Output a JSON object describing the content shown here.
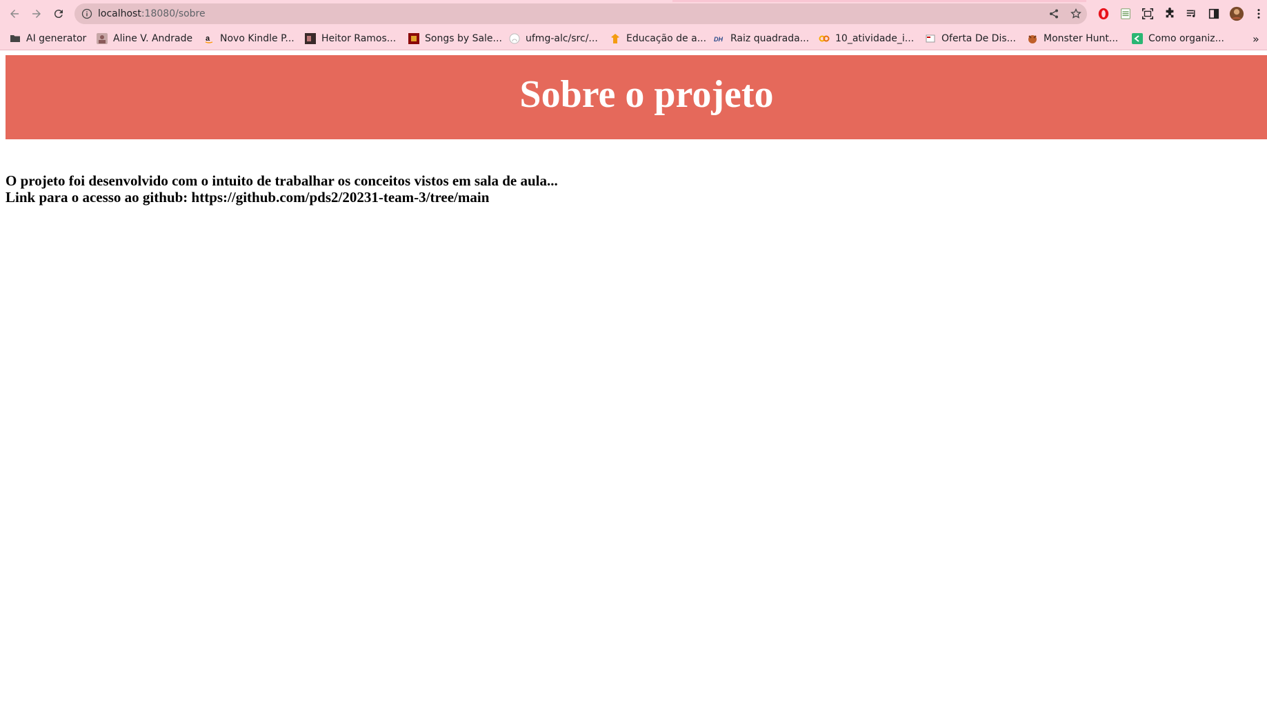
{
  "browser": {
    "url_host": "localhost",
    "url_path": ":18080/sobre",
    "bookmarks": [
      {
        "label": "AI generator",
        "icon": "folder-icon"
      },
      {
        "label": "Aline V. Andrade",
        "icon": "avatar-favicon"
      },
      {
        "label": "Novo Kindle P...",
        "icon": "amazon-favicon"
      },
      {
        "label": "Heitor Ramos...",
        "icon": "image-favicon"
      },
      {
        "label": "Songs by Sale...",
        "icon": "music-favicon"
      },
      {
        "label": "ufmg-alc/src/...",
        "icon": "github-favicon"
      },
      {
        "label": "Educação de a...",
        "icon": "orange-favicon"
      },
      {
        "label": "Raiz quadrada...",
        "icon": "math-favicon"
      },
      {
        "label": "10_atividade_i...",
        "icon": "colab-favicon"
      },
      {
        "label": "Oferta De Dis...",
        "icon": "doc-favicon"
      },
      {
        "label": "Monster Hunt...",
        "icon": "game-favicon"
      },
      {
        "label": "Como organiz...",
        "icon": "green-favicon"
      }
    ],
    "more_bookmarks": "»"
  },
  "page": {
    "title": "Sobre o projeto",
    "line1": "O projeto foi desenvolvido com o intuito de trabalhar os conceitos vistos em sala de aula...",
    "line2": "Link para o acesso ao github: https://github.com/pds2/20231-team-3/tree/main"
  },
  "colors": {
    "header_bg": "#e5695b",
    "chrome_bg": "#fcd7e0",
    "omnibox_bg": "#e5c1c7"
  }
}
